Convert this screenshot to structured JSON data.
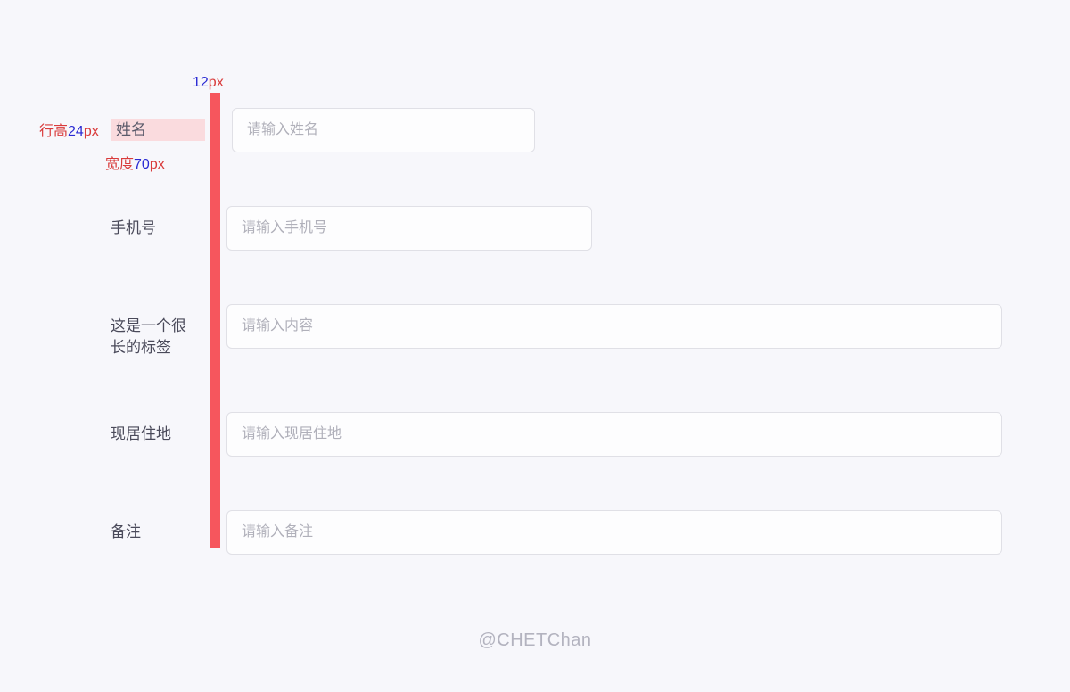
{
  "annotations": {
    "gap": {
      "value": "12",
      "unit": "px"
    },
    "lineHeight": {
      "prefix": "行高",
      "value": "24",
      "unit": "px"
    },
    "width": {
      "prefix": "宽度",
      "value": "70",
      "unit": "px"
    }
  },
  "form": {
    "name": {
      "label": "姓名",
      "placeholder": "请输入姓名"
    },
    "phone": {
      "label": "手机号",
      "placeholder": "请输入手机号"
    },
    "longLabel": {
      "label": "这是一个很长的标签",
      "placeholder": "请输入内容"
    },
    "address": {
      "label": "现居住地",
      "placeholder": "请输入现居住地"
    },
    "remark": {
      "label": "备注",
      "placeholder": "请输入备注"
    }
  },
  "watermark": "@CHETChan"
}
